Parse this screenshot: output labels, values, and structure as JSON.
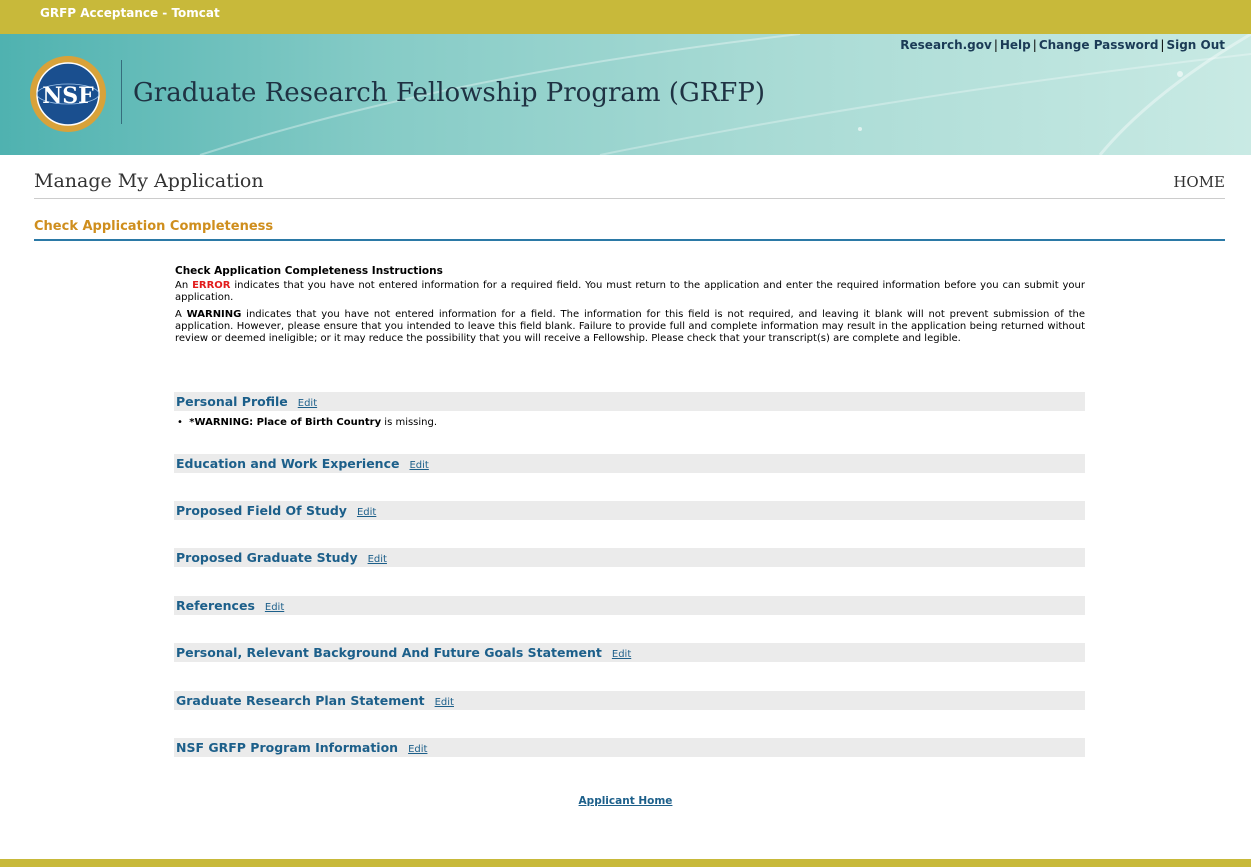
{
  "env_label": "GRFP Acceptance - Tomcat",
  "top_links": [
    "Research.gov",
    "Help",
    "Change Password",
    "Sign Out"
  ],
  "program_title": "Graduate Research Fellowship Program (GRFP)",
  "logo_text": "NSF",
  "page_title": "Manage My Application",
  "home_label": "HOME",
  "section_heading": "Check Application Completeness",
  "instructions": {
    "title": "Check Application Completeness Instructions",
    "error_prefix": "An ",
    "error_word": "ERROR",
    "error_text": " indicates that you have not entered information for a required field. You must return to the application and enter the required information before you can submit your application.",
    "warning_prefix": "A ",
    "warning_word": "WARNING",
    "warning_text": " indicates that you have not entered information for a field. The information for this field is not required, and leaving it blank will not prevent submission of the application. However, please ensure that you intended to leave this field blank. Failure to provide full and complete information may result in the application being returned without review or deemed ineligible; or it may reduce the possibility that you will receive a Fellowship. Please check that your transcript(s) are complete and legible."
  },
  "sections": [
    {
      "title": "Personal Profile",
      "edit": "Edit"
    },
    {
      "title": "Education and Work Experience",
      "edit": "Edit"
    },
    {
      "title": "Proposed Field Of Study",
      "edit": "Edit"
    },
    {
      "title": "Proposed Graduate Study",
      "edit": "Edit"
    },
    {
      "title": "References",
      "edit": "Edit"
    },
    {
      "title": "Personal, Relevant Background And Future Goals Statement",
      "edit": "Edit"
    },
    {
      "title": "Graduate Research Plan Statement",
      "edit": "Edit"
    },
    {
      "title": "NSF GRFP Program Information",
      "edit": "Edit"
    }
  ],
  "warning_item": {
    "bold": "*WARNING: Place of Birth Country",
    "rest": " is missing."
  },
  "applicant_home": "Applicant Home"
}
